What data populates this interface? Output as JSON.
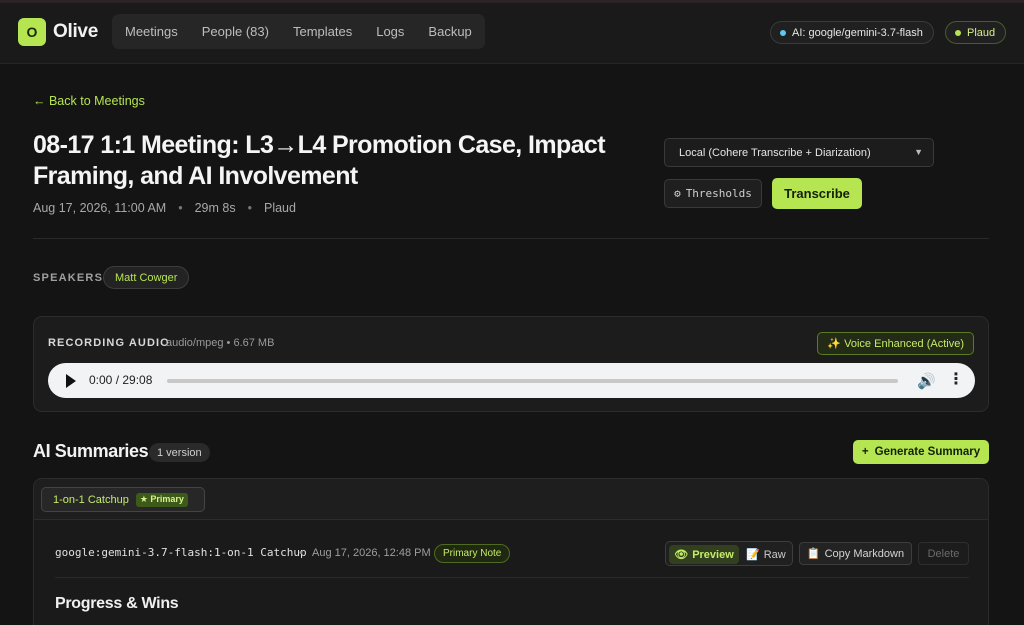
{
  "app": {
    "logo_letter": "O",
    "name": "Olive"
  },
  "nav": {
    "tabs": [
      {
        "label": "Meetings"
      },
      {
        "label": "People (83)"
      },
      {
        "label": "Templates"
      },
      {
        "label": "Logs"
      },
      {
        "label": "Backup"
      }
    ]
  },
  "status": {
    "ai_label": "AI: google/gemini-3.7-flash",
    "ai_dot_color": "#5ec8f0",
    "source_label": "Plaud",
    "source_dot_color": "#b5e550"
  },
  "back_link": "← Back to Meetings",
  "meeting": {
    "title": "08-17 1:1 Meeting: L3→L4 Promotion Case, Impact Framing, and AI Involvement",
    "date": "Aug 17, 2026, 11:00 AM",
    "duration": "29m 8s",
    "source": "Plaud",
    "separator": "•"
  },
  "transcribe": {
    "engine_selected": "Local (Cohere Transcribe + Diarization)",
    "thresholds_icon": "gear-icon",
    "thresholds_label": "Thresholds",
    "transcribe_label": "Transcribe"
  },
  "speakers": {
    "label": "SPEAKERS:",
    "list": [
      "Matt Cowger"
    ]
  },
  "recording": {
    "label": "RECORDING AUDIO",
    "meta": "audio/mpeg • 6.67 MB",
    "voice_badge": "✨ Voice Enhanced (Active)",
    "time": "0:00 / 29:08",
    "progress": 0
  },
  "summaries": {
    "title": "AI Summaries",
    "version_count": "1 version",
    "generate_label": "Generate Summary",
    "generate_icon": "+",
    "version_tab": {
      "label": "1-on-1 Catchup",
      "badge": "★ Primary"
    },
    "note": {
      "id": "google:gemini-3.7-flash:1-on-1 Catchup",
      "sep": "•",
      "date": "Aug 17, 2026, 12:48 PM",
      "badge": "Primary Note"
    },
    "actions": {
      "preview_label": "Preview",
      "preview_icon": "👁",
      "raw_label": "Raw",
      "raw_icon": "📝",
      "copy_label": "Copy Markdown",
      "copy_icon": "📋",
      "delete_label": "Delete"
    },
    "section_heading": "Progress & Wins"
  },
  "colors": {
    "accent": "#b5e550",
    "background": "#141414"
  }
}
